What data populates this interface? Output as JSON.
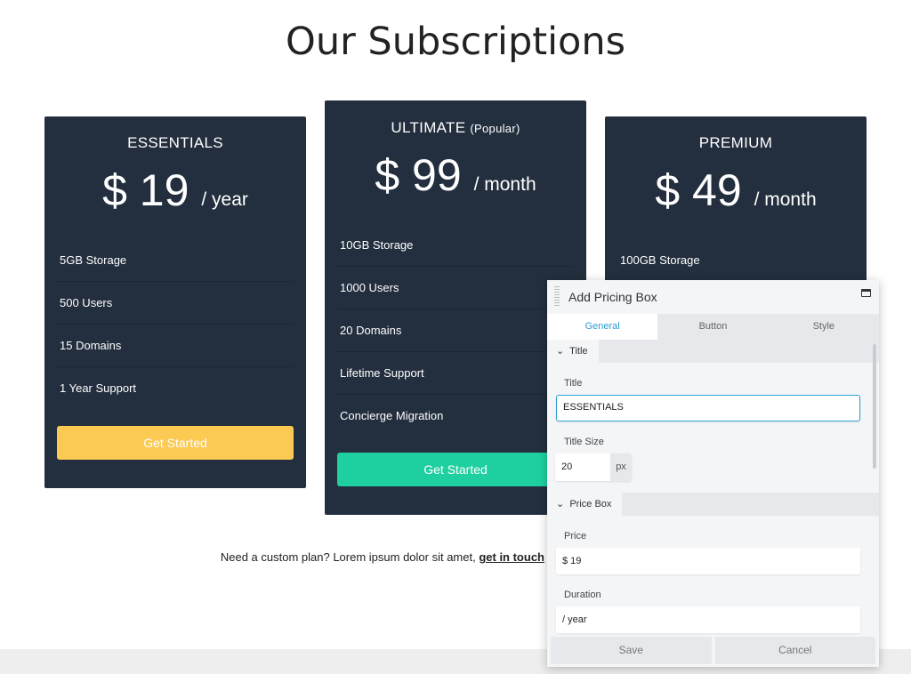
{
  "page_title": "Our Subscriptions",
  "colors": {
    "card_bg": "#232f3e",
    "essentials_button": "#fcc953",
    "ultimate_button": "#1ed09f",
    "accent": "#2d9cd0"
  },
  "plans": [
    {
      "title": "ESSENTIALS",
      "tag": "",
      "price": "$ 19",
      "period": "/ year",
      "features": [
        "5GB Storage",
        "500 Users",
        "15 Domains",
        "1 Year Support"
      ],
      "button": "Get Started"
    },
    {
      "title": "ULTIMATE",
      "tag": "(Popular)",
      "price": "$ 99",
      "period": "/ month",
      "features": [
        "10GB Storage",
        "1000 Users",
        "20 Domains",
        "Lifetime Support",
        "Concierge Migration"
      ],
      "button": "Get Started"
    },
    {
      "title": "PREMIUM",
      "tag": "",
      "price": "$ 49",
      "period": "/ month",
      "features": [
        "100GB Storage"
      ]
    }
  ],
  "footer": {
    "text": "Need a custom plan? Lorem ipsum dolor sit amet, ",
    "link": "get in touch"
  },
  "modal": {
    "title": "Add Pricing Box",
    "tabs": [
      "General",
      "Button",
      "Style"
    ],
    "title_section": {
      "heading": "Title",
      "title_label": "Title",
      "title_value": "ESSENTIALS",
      "size_label": "Title Size",
      "size_value": "20",
      "size_unit": "px"
    },
    "price_section": {
      "heading": "Price Box",
      "price_label": "Price",
      "price_value": "$ 19",
      "duration_label": "Duration",
      "duration_value": "/ year"
    },
    "save": "Save",
    "cancel": "Cancel"
  }
}
